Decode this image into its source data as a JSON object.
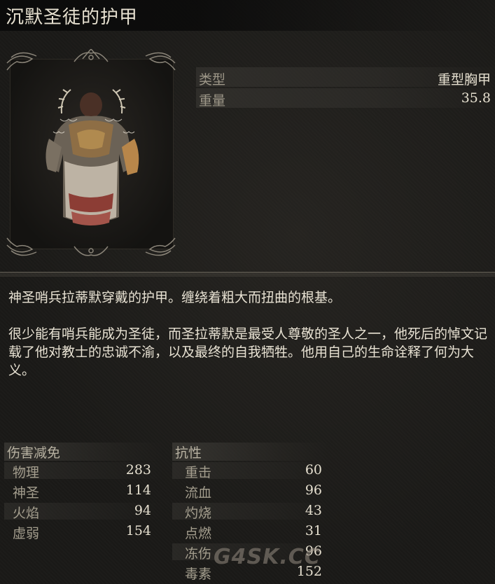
{
  "item": {
    "title": "沉默圣徒的护甲"
  },
  "properties": [
    {
      "label": "类型",
      "value": "重型胸甲"
    },
    {
      "label": "重量",
      "value": "35.8"
    }
  ],
  "description": [
    "神圣哨兵拉蒂默穿戴的护甲。缠绕着粗大而扭曲的根基。",
    "很少能有哨兵能成为圣徒，而圣拉蒂默是最受人尊敬的圣人之一，他死后的悼文记载了他对教士的忠诚不渝，以及最终的自我牺牲。他用自己的生命诠释了何为大义。"
  ],
  "damage_negation": {
    "header": "伤害减免",
    "rows": [
      {
        "label": "物理",
        "value": "283"
      },
      {
        "label": "神圣",
        "value": "114"
      },
      {
        "label": "火焰",
        "value": "94"
      },
      {
        "label": "虚弱",
        "value": "154"
      }
    ]
  },
  "resistance": {
    "header": "抗性",
    "rows": [
      {
        "label": "重击",
        "value": "60"
      },
      {
        "label": "流血",
        "value": "96"
      },
      {
        "label": "灼烧",
        "value": "43"
      },
      {
        "label": "点燃",
        "value": "31"
      },
      {
        "label": "冻伤",
        "value": "96"
      },
      {
        "label": "毒素",
        "value": "152"
      }
    ]
  },
  "watermark": "G4SK.CC",
  "icons": {
    "portrait": "armor-chest-icon",
    "ornament": "filigree-ornament-icon"
  }
}
